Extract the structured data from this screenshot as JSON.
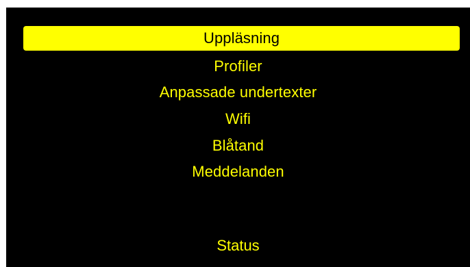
{
  "colors": {
    "background": "#000000",
    "accent": "#FFFF00",
    "selected_text": "#000000"
  },
  "menu": {
    "items": [
      {
        "label": "Uppläsning",
        "selected": true
      },
      {
        "label": "Profiler",
        "selected": false
      },
      {
        "label": "Anpassade undertexter",
        "selected": false
      },
      {
        "label": "Wifi",
        "selected": false
      },
      {
        "label": "Blåtand",
        "selected": false
      },
      {
        "label": "Meddelanden",
        "selected": false
      }
    ]
  },
  "footer": {
    "status_label": "Status"
  }
}
